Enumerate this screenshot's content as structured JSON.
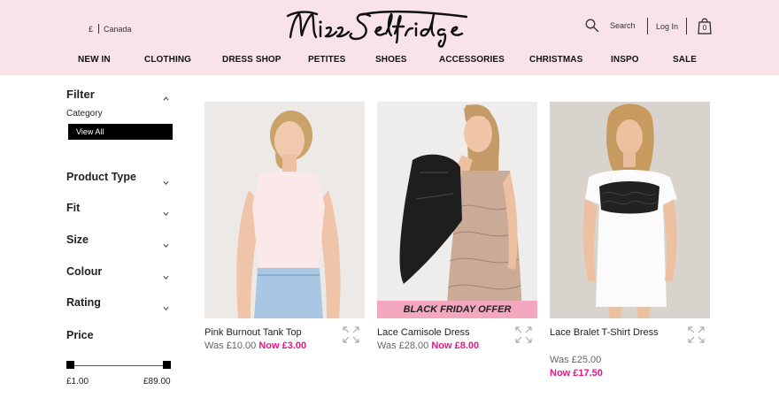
{
  "header": {
    "currency": "£",
    "country": "Canada",
    "search_label": "Search",
    "login_label": "Log In",
    "bag_count": "0",
    "brand_color": "#f8e4e8"
  },
  "nav": {
    "items": [
      "NEW IN",
      "CLOTHING",
      "DRESS SHOP",
      "PETITES",
      "SHOES",
      "ACCESSORIES",
      "CHRISTMAS",
      "INSPO",
      "SALE"
    ]
  },
  "sidebar": {
    "filter_title": "Filter",
    "category_label": "Category",
    "view_all_label": "View All",
    "facets": [
      "Product Type",
      "Fit",
      "Size",
      "Colour",
      "Rating"
    ],
    "price_title": "Price",
    "price_min": "£1.00",
    "price_max": "£89.00"
  },
  "products": [
    {
      "name": "Pink Burnout Tank Top",
      "was": "Was £10.00",
      "now": "Now £3.00",
      "promo": "",
      "image": "model-in-pink-tank-top"
    },
    {
      "name": "Lace Camisole Dress",
      "was": "Was £28.00",
      "now": "Now £8.00",
      "promo": "BLACK FRIDAY OFFER",
      "image": "model-in-lace-camisole-dress"
    },
    {
      "name": "Lace Bralet T-Shirt Dress",
      "was": "Was £25.00",
      "now": "Now £17.50",
      "promo": "",
      "image": "model-in-white-tshirt-dress"
    }
  ],
  "colors": {
    "sale_price": "#e2178a",
    "promo_banner": "#f4a8c0"
  }
}
